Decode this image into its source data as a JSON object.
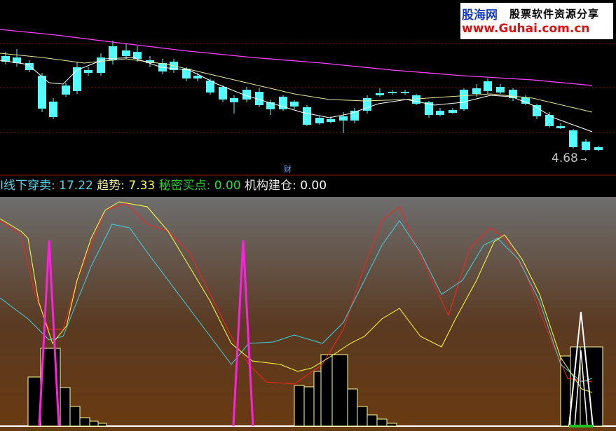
{
  "watermark": {
    "brand": "股海网",
    "tagline": "股票软件资源分享",
    "url": "www.Guhai.com.cn"
  },
  "price_label": "4.68",
  "cai_tag": "财",
  "indicator": {
    "items": [
      {
        "label": "I线下穿卖: ",
        "value": "17.22",
        "color": "cyan"
      },
      {
        "label": "趋势: ",
        "value": "7.33",
        "color": "yellow"
      },
      {
        "label": "秘密买点: ",
        "value": "0.00",
        "color": "green"
      },
      {
        "label": "机构建仓: ",
        "value": "0.00",
        "color": "white"
      }
    ]
  },
  "colors": {
    "up": "#ff3232",
    "down": "#54fcfc",
    "ma_slow": "#ff40ff",
    "ma_mid": "#e8e8a0",
    "ma_fast": "#ffffff",
    "line_red": "#ff2020",
    "line_cyan": "#40d0e0",
    "line_yellow": "#ffff40",
    "spike_magenta": "#ff20e0",
    "spike_white": "#ffffff"
  }
}
